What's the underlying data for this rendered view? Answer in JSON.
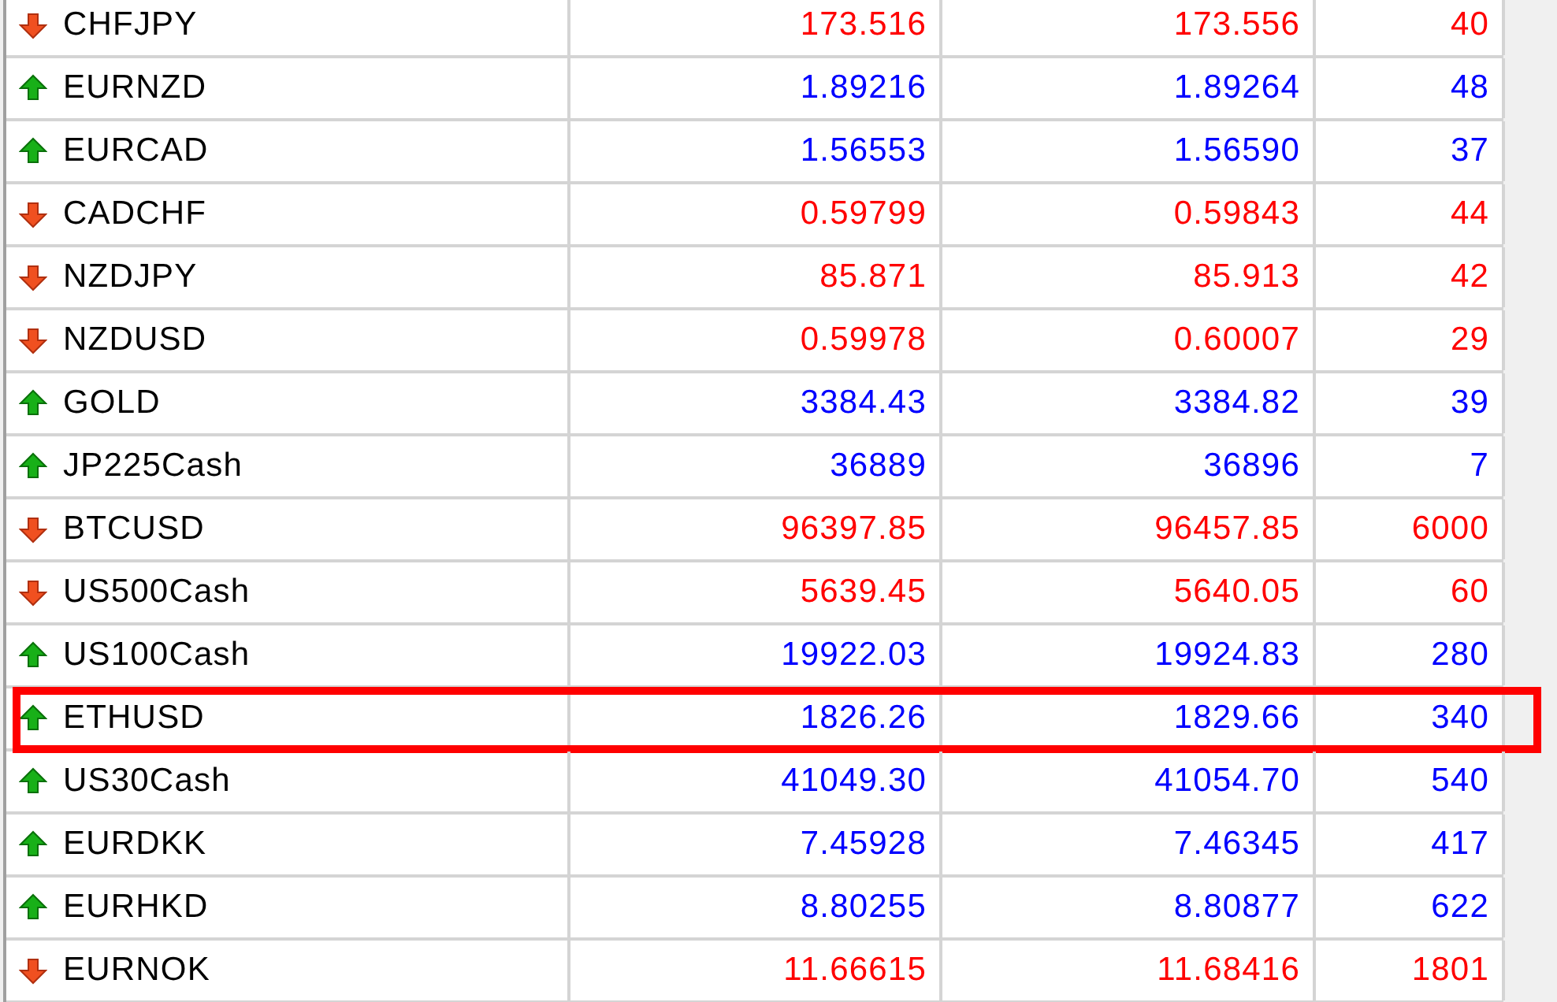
{
  "rows": [
    {
      "symbol": "CHFJPY",
      "kind": "down",
      "bid": "173.516",
      "ask": "173.556",
      "spread": "40",
      "highlighted": false
    },
    {
      "symbol": "EURNZD",
      "kind": "up",
      "bid": "1.89216",
      "ask": "1.89264",
      "spread": "48",
      "highlighted": false
    },
    {
      "symbol": "EURCAD",
      "kind": "up",
      "bid": "1.56553",
      "ask": "1.56590",
      "spread": "37",
      "highlighted": false
    },
    {
      "symbol": "CADCHF",
      "kind": "down",
      "bid": "0.59799",
      "ask": "0.59843",
      "spread": "44",
      "highlighted": false
    },
    {
      "symbol": "NZDJPY",
      "kind": "down",
      "bid": "85.871",
      "ask": "85.913",
      "spread": "42",
      "highlighted": false
    },
    {
      "symbol": "NZDUSD",
      "kind": "down",
      "bid": "0.59978",
      "ask": "0.60007",
      "spread": "29",
      "highlighted": false
    },
    {
      "symbol": "GOLD",
      "kind": "up",
      "bid": "3384.43",
      "ask": "3384.82",
      "spread": "39",
      "highlighted": false
    },
    {
      "symbol": "JP225Cash",
      "kind": "up",
      "bid": "36889",
      "ask": "36896",
      "spread": "7",
      "highlighted": false
    },
    {
      "symbol": "BTCUSD",
      "kind": "down",
      "bid": "96397.85",
      "ask": "96457.85",
      "spread": "6000",
      "highlighted": false
    },
    {
      "symbol": "US500Cash",
      "kind": "down",
      "bid": "5639.45",
      "ask": "5640.05",
      "spread": "60",
      "highlighted": false
    },
    {
      "symbol": "US100Cash",
      "kind": "up",
      "bid": "19922.03",
      "ask": "19924.83",
      "spread": "280",
      "highlighted": false
    },
    {
      "symbol": "ETHUSD",
      "kind": "up",
      "bid": "1826.26",
      "ask": "1829.66",
      "spread": "340",
      "highlighted": true
    },
    {
      "symbol": "US30Cash",
      "kind": "up",
      "bid": "41049.30",
      "ask": "41054.70",
      "spread": "540",
      "highlighted": false
    },
    {
      "symbol": "EURDKK",
      "kind": "up",
      "bid": "7.45928",
      "ask": "7.46345",
      "spread": "417",
      "highlighted": false
    },
    {
      "symbol": "EURHKD",
      "kind": "up",
      "bid": "8.80255",
      "ask": "8.80877",
      "spread": "622",
      "highlighted": false
    },
    {
      "symbol": "EURNOK",
      "kind": "down",
      "bid": "11.66615",
      "ask": "11.68416",
      "spread": "1801",
      "highlighted": false
    }
  ]
}
